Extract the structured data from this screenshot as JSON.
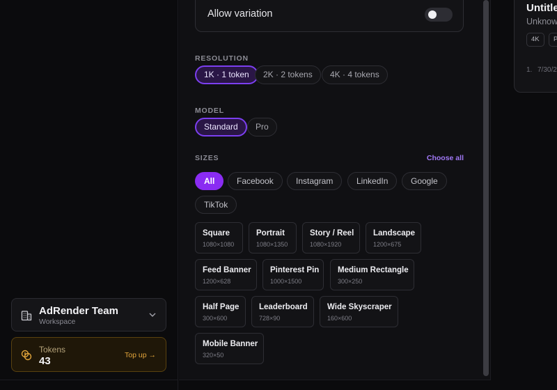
{
  "sidebar": {
    "team": {
      "name": "AdRender Team",
      "subtitle": "Workspace",
      "icon": "building-icon"
    },
    "tokens": {
      "label": "Tokens",
      "value": "43",
      "top_up_label": "Top up →",
      "icon": "coins-icon"
    }
  },
  "settings": {
    "allow_variation": {
      "label": "Allow variation",
      "enabled": false
    },
    "resolution": {
      "label": "RESOLUTION",
      "options": [
        "1K · 1 token",
        "2K · 2 tokens",
        "4K · 4 tokens"
      ],
      "selected": "1K · 1 token"
    },
    "model": {
      "label": "MODEL",
      "options": [
        "Standard",
        "Pro"
      ],
      "selected": "Standard"
    },
    "sizes": {
      "label": "SIZES",
      "choose_all_label": "Choose all",
      "filters": [
        "All",
        "Facebook",
        "Instagram",
        "LinkedIn",
        "Google",
        "TikTok"
      ],
      "selected_filter": "All",
      "items": [
        {
          "name": "Square",
          "dims": "1080×1080"
        },
        {
          "name": "Portrait",
          "dims": "1080×1350"
        },
        {
          "name": "Story / Reel",
          "dims": "1080×1920"
        },
        {
          "name": "Landscape",
          "dims": "1200×675"
        },
        {
          "name": "Feed Banner",
          "dims": "1200×628"
        },
        {
          "name": "Pinterest Pin",
          "dims": "1000×1500"
        },
        {
          "name": "Medium Rectangle",
          "dims": "300×250"
        },
        {
          "name": "Half Page",
          "dims": "300×600"
        },
        {
          "name": "Leaderboard",
          "dims": "728×90"
        },
        {
          "name": "Wide Skyscraper",
          "dims": "160×600"
        },
        {
          "name": "Mobile Banner",
          "dims": "320×50"
        }
      ]
    }
  },
  "right_card": {
    "title": "Untitled",
    "subtitle": "Unknown",
    "tags": [
      "4K",
      "P"
    ],
    "meta_count": "1.",
    "meta_date": "7/30/2"
  },
  "colors": {
    "accent": "#8a2cf2",
    "accent_selected_border": "#7c3ff0",
    "tokens_accent": "#e3a53b"
  }
}
